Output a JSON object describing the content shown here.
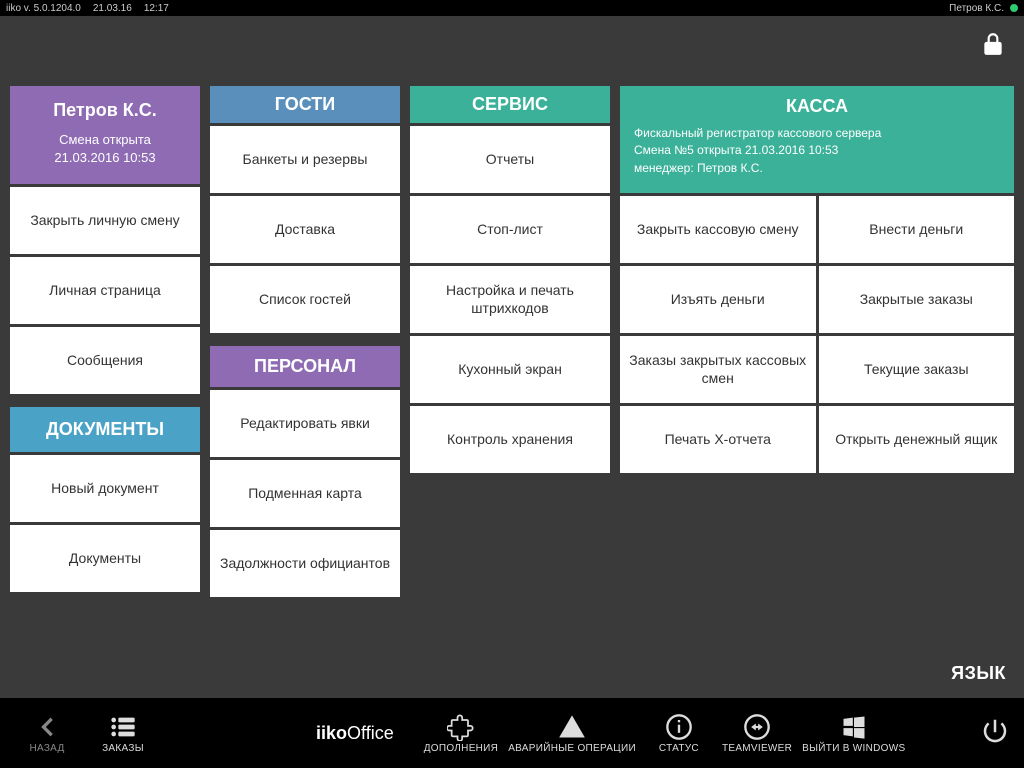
{
  "top": {
    "version": "iiko  v. 5.0.1204.0",
    "date": "21.03.16",
    "time": "12:17",
    "user": "Петров К.С."
  },
  "user_panel": {
    "name": "Петров К.С.",
    "shift_line1": "Смена открыта",
    "shift_line2": "21.03.2016 10:53",
    "items": [
      "Закрыть личную смену",
      "Личная страница",
      "Сообщения"
    ]
  },
  "documents": {
    "title": "ДОКУМЕНТЫ",
    "items": [
      "Новый документ",
      "Документы"
    ]
  },
  "guests": {
    "title": "ГОСТИ",
    "items": [
      "Банкеты и резервы",
      "Доставка",
      "Список гостей"
    ]
  },
  "personnel": {
    "title": "ПЕРСОНАЛ",
    "items": [
      "Редактировать явки",
      "Подменная карта",
      "Задолжности официантов"
    ]
  },
  "service": {
    "title": "СЕРВИС",
    "items": [
      "Отчеты",
      "Стоп-лист",
      "Настройка и печать штрихкодов",
      "Кухонный экран",
      "Контроль хранения"
    ]
  },
  "cash": {
    "title": "КАССА",
    "sub1": "Фискальный регистратор кассового сервера",
    "sub2": "Смена №5 открыта 21.03.2016 10:53",
    "sub3": "менеджер: Петров К.С.",
    "grid": [
      "Закрыть кассовую смену",
      "Внести деньги",
      "Изъять деньги",
      "Закрытые заказы",
      "Заказы закрытых кассовых смен",
      "Текущие заказы",
      "Печать X-отчета",
      "Открыть денежный ящик"
    ]
  },
  "language_label": "ЯЗЫК",
  "bottom": {
    "back": "НАЗАД",
    "orders": "ЗАКАЗЫ",
    "office_bold": "iiko",
    "office_thin": "Office",
    "addons": "ДОПОЛНЕНИЯ",
    "emergency": "АВАРИЙНЫЕ ОПЕРАЦИИ",
    "status": "СТАТУС",
    "teamviewer": "TEAMVIEWER",
    "exit_windows": "ВЫЙТИ В WINDOWS"
  }
}
